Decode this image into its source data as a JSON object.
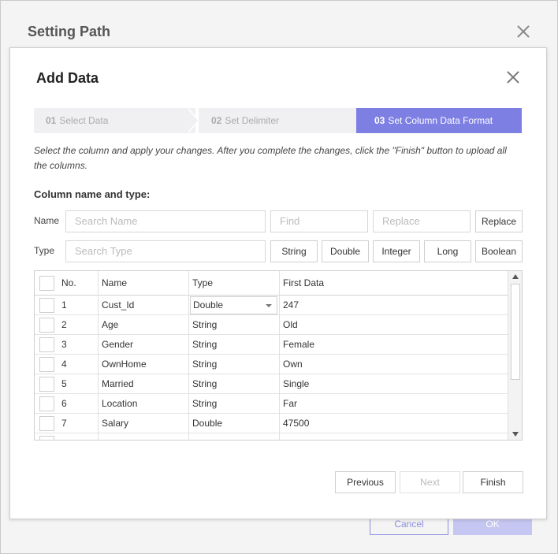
{
  "outer": {
    "title": "Setting Path",
    "cancel_label": "Cancel",
    "ok_label": "OK"
  },
  "dialog": {
    "title": "Add Data",
    "steps": [
      {
        "num": "01",
        "label": "Select Data",
        "active": false
      },
      {
        "num": "02",
        "label": "Set Delimiter",
        "active": false
      },
      {
        "num": "03",
        "label": "Set Column Data Format",
        "active": true
      }
    ],
    "description": "Select the column and apply your changes. After you complete the changes, click the \"Finish\" button to upload all the columns.",
    "section_label": "Column name and type:",
    "name_row": {
      "label": "Name",
      "search_placeholder": "Search Name",
      "find_placeholder": "Find",
      "replace_placeholder": "Replace",
      "replace_button": "Replace"
    },
    "type_row": {
      "label": "Type",
      "search_placeholder": "Search Type",
      "buttons": [
        "String",
        "Double",
        "Integer",
        "Long",
        "Boolean"
      ]
    },
    "table": {
      "headers": {
        "no": "No.",
        "name": "Name",
        "type": "Type",
        "first_data": "First Data"
      },
      "rows": [
        {
          "no": "1",
          "name": "Cust_Id",
          "type": "Double",
          "first_data": "247"
        },
        {
          "no": "2",
          "name": "Age",
          "type": "String",
          "first_data": "Old"
        },
        {
          "no": "3",
          "name": "Gender",
          "type": "String",
          "first_data": "Female"
        },
        {
          "no": "4",
          "name": "OwnHome",
          "type": "String",
          "first_data": "Own"
        },
        {
          "no": "5",
          "name": "Married",
          "type": "String",
          "first_data": "Single"
        },
        {
          "no": "6",
          "name": "Location",
          "type": "String",
          "first_data": "Far"
        },
        {
          "no": "7",
          "name": "Salary",
          "type": "Double",
          "first_data": "47500"
        }
      ]
    },
    "footer": {
      "previous_label": "Previous",
      "next_label": "Next",
      "finish_label": "Finish"
    }
  },
  "colors": {
    "accent": "#7e7fe3",
    "step_inactive": "#f0f0f3"
  }
}
